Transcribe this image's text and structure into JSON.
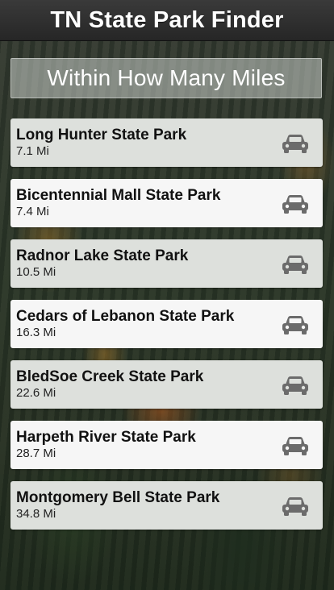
{
  "header": {
    "title": "TN State Park Finder"
  },
  "filter": {
    "label": "Within How Many Miles"
  },
  "parks": [
    {
      "name": "Long Hunter State Park",
      "distance": "7.1 Mi",
      "icon": "car-icon"
    },
    {
      "name": "Bicentennial Mall State Park",
      "distance": "7.4 Mi",
      "icon": "car-icon"
    },
    {
      "name": "Radnor Lake State Park",
      "distance": "10.5 Mi",
      "icon": "car-icon"
    },
    {
      "name": "Cedars of Lebanon State Park",
      "distance": "16.3 Mi",
      "icon": "car-icon"
    },
    {
      "name": "BledSoe Creek State Park",
      "distance": "22.6 Mi",
      "icon": "car-icon"
    },
    {
      "name": "Harpeth River State Park",
      "distance": "28.7 Mi",
      "icon": "car-icon"
    },
    {
      "name": "Montgomery Bell State Park",
      "distance": "34.8 Mi",
      "icon": "car-icon"
    }
  ],
  "colors": {
    "header_bg": "#2b2b2b",
    "row_alt_a": "#dde0dc",
    "row_alt_b": "#f6f6f6",
    "icon": "#6b6b6b"
  }
}
